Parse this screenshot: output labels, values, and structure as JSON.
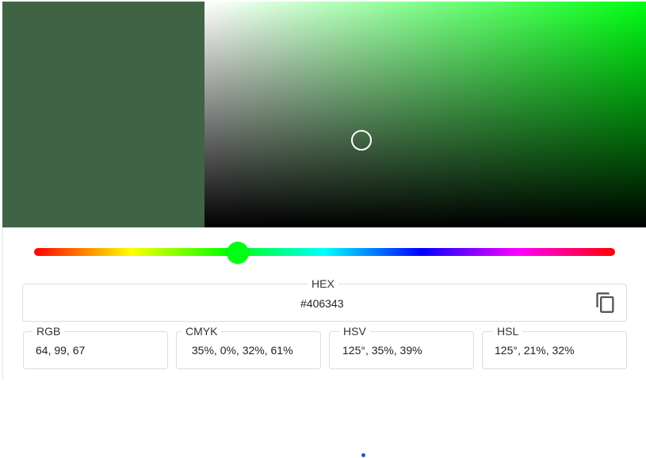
{
  "colors": {
    "selected": "#406343",
    "hue_pure": "#00ff12",
    "hue_thumb": "#00ff12",
    "indicator_dot": "#1a56c9"
  },
  "picker": {
    "hue_degrees": 125,
    "saturation": 0.35,
    "value": 0.39
  },
  "hex": {
    "label": "HEX",
    "value": "#406343",
    "copy_icon": "copy-icon"
  },
  "formats": {
    "rgb": {
      "label": "RGB",
      "value": "64, 99, 67"
    },
    "cmyk": {
      "label": "CMYK",
      "value": " 35%, 0%, 32%, 61%"
    },
    "hsv": {
      "label": "HSV",
      "value": "125°, 35%, 39%"
    },
    "hsl": {
      "label": "HSL",
      "value": "125°, 21%, 32%"
    }
  }
}
